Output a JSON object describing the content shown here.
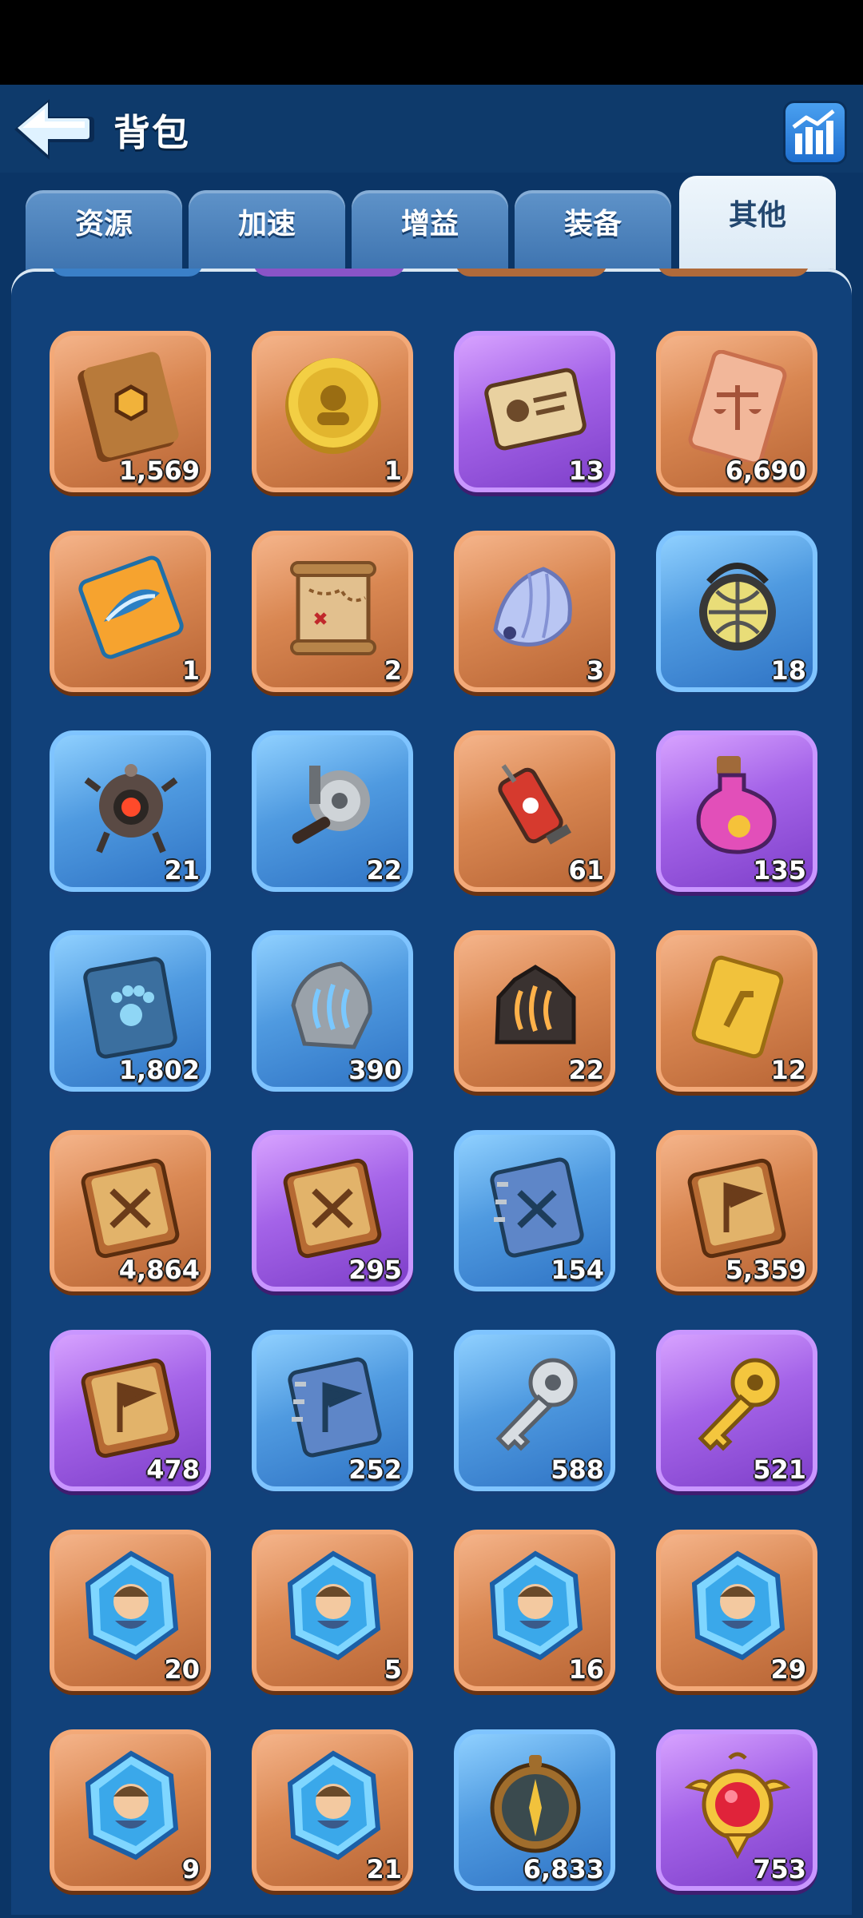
{
  "header": {
    "title": "背包",
    "back_icon": "arrow-left-icon",
    "stats_icon": "bar-chart-icon"
  },
  "tabs": [
    {
      "label": "资源",
      "active": false
    },
    {
      "label": "加速",
      "active": false
    },
    {
      "label": "增益",
      "active": false
    },
    {
      "label": "装备",
      "active": false
    },
    {
      "label": "其他",
      "active": true
    }
  ],
  "colors": {
    "orange": "#d98752",
    "blue": "#4f9ae0",
    "purple": "#a463e8",
    "background": "#0b3566"
  },
  "items": [
    {
      "qty": "1,569",
      "rarity": "orange",
      "icon": "hexagon-book-icon"
    },
    {
      "qty": "1",
      "rarity": "orange",
      "icon": "gold-coin-icon"
    },
    {
      "qty": "13",
      "rarity": "purple",
      "icon": "id-card-icon"
    },
    {
      "qty": "6,690",
      "rarity": "orange",
      "icon": "scale-ticket-icon"
    },
    {
      "qty": "1",
      "rarity": "orange",
      "icon": "fish-ticket-icon"
    },
    {
      "qty": "2",
      "rarity": "orange",
      "icon": "treasure-map-icon"
    },
    {
      "qty": "3",
      "rarity": "orange",
      "icon": "shell-icon"
    },
    {
      "qty": "18",
      "rarity": "blue",
      "icon": "lantern-icon"
    },
    {
      "qty": "21",
      "rarity": "blue",
      "icon": "robot-drone-icon"
    },
    {
      "qty": "22",
      "rarity": "blue",
      "icon": "fishing-reel-icon"
    },
    {
      "qty": "61",
      "rarity": "orange",
      "icon": "syringe-icon"
    },
    {
      "qty": "135",
      "rarity": "purple",
      "icon": "potion-icon"
    },
    {
      "qty": "1,802",
      "rarity": "blue",
      "icon": "paw-book-icon"
    },
    {
      "qty": "390",
      "rarity": "blue",
      "icon": "claw-stone-icon"
    },
    {
      "qty": "22",
      "rarity": "orange",
      "icon": "claw-rock-icon"
    },
    {
      "qty": "12",
      "rarity": "orange",
      "icon": "gold-card-icon"
    },
    {
      "qty": "4,864",
      "rarity": "orange",
      "icon": "sword-book-icon"
    },
    {
      "qty": "295",
      "rarity": "purple",
      "icon": "sword-book-icon"
    },
    {
      "qty": "154",
      "rarity": "blue",
      "icon": "sword-notebook-icon"
    },
    {
      "qty": "5,359",
      "rarity": "orange",
      "icon": "flag-book-icon"
    },
    {
      "qty": "478",
      "rarity": "purple",
      "icon": "flag-book-icon"
    },
    {
      "qty": "252",
      "rarity": "blue",
      "icon": "flag-notebook-icon"
    },
    {
      "qty": "588",
      "rarity": "blue",
      "icon": "silver-key-icon"
    },
    {
      "qty": "521",
      "rarity": "purple",
      "icon": "gold-key-icon"
    },
    {
      "qty": "20",
      "rarity": "orange",
      "icon": "hero-shard-icon"
    },
    {
      "qty": "5",
      "rarity": "orange",
      "icon": "hero-shard-icon"
    },
    {
      "qty": "16",
      "rarity": "orange",
      "icon": "hero-shard-icon"
    },
    {
      "qty": "29",
      "rarity": "orange",
      "icon": "hero-shard-icon"
    },
    {
      "qty": "9",
      "rarity": "orange",
      "icon": "hero-shard-icon"
    },
    {
      "qty": "21",
      "rarity": "orange",
      "icon": "hero-shard-icon"
    },
    {
      "qty": "6,833",
      "rarity": "blue",
      "icon": "compass-icon"
    },
    {
      "qty": "753",
      "rarity": "purple",
      "icon": "ruby-amulet-icon"
    }
  ]
}
